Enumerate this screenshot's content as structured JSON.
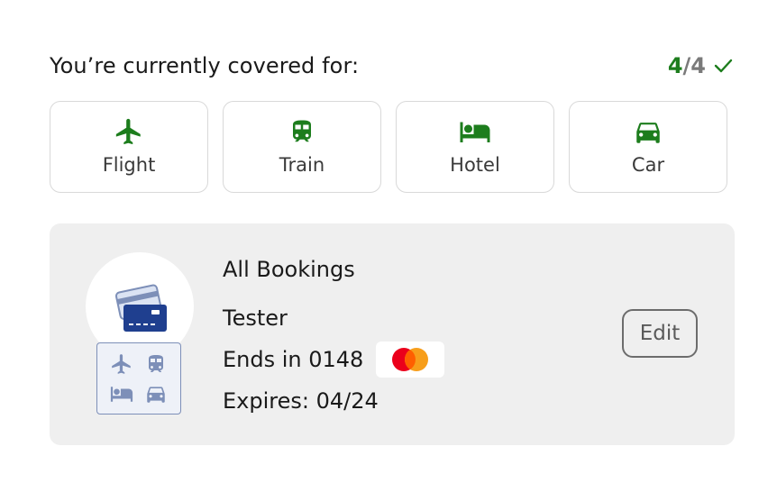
{
  "coverage": {
    "title": "You’re currently covered for:",
    "covered_count": "4",
    "separator": "/",
    "total_count": "4",
    "check_icon": "check-icon"
  },
  "categories": [
    {
      "label": "Flight",
      "icon": "airplane-icon",
      "color": "#1d7d1d"
    },
    {
      "label": "Train",
      "icon": "train-icon",
      "color": "#1d7d1d"
    },
    {
      "label": "Hotel",
      "icon": "bed-icon",
      "color": "#1d7d1d"
    },
    {
      "label": "Car",
      "icon": "car-icon",
      "color": "#1d7d1d"
    }
  ],
  "payment_card": {
    "scope": "All Bookings",
    "holder": "Tester",
    "ends_in": "Ends in 0148",
    "expires": "Expires: 04/24",
    "brand_icon": "mastercard-logo",
    "edit_label": "Edit"
  },
  "colors": {
    "accent_green": "#1d7d1d",
    "card_background": "#efefef",
    "wallet_blue": "#1f3f8f",
    "mode_icon_gray_blue": "#7d8fb8"
  }
}
